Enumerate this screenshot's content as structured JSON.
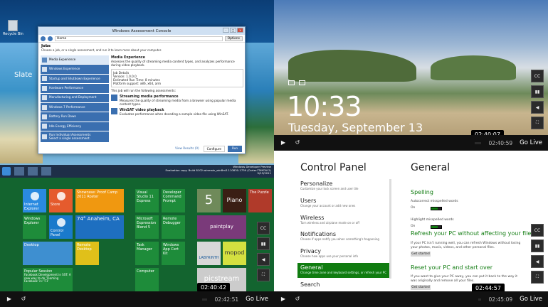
{
  "q1": {
    "desktop": {
      "recycle_label": "Recycle Bin",
      "slate_label": "Slate"
    },
    "window": {
      "title": "Windows Assessment Console",
      "nav_home": "Home",
      "options_label": "Options",
      "jobs_heading": "Jobs",
      "jobs_sub": "Choose a job, or a single assessment, and run it to learn more about your computer.",
      "jobs": [
        "Media Experience",
        "Windows Experience",
        "Startup and Shutdown Experience",
        "Hardware Performance",
        "Manufacturing and Deployment",
        "Windows 7 Performance",
        "Battery Run Down",
        "Idle Energy Efficiency",
        "Run Individual Assessments\nSelect a single assessment."
      ],
      "detail_title": "Media Experience",
      "detail_desc": "Assesses the quality of streaming media content types, and analyzes performance during video playback.",
      "job_details_label": "Job Details",
      "version_label": "Version:",
      "version_value": "1.0.0.0",
      "run_time_label": "Estimated Run Time:",
      "run_time_value": "8 minutes",
      "platform_label": "Platform support:",
      "platform_value": "x86, x64, arm",
      "runs_label": "This job will run the following assessments:",
      "assessments": [
        {
          "name": "Streaming media performance",
          "desc": "Measures the quality of streaming media from a browser using popular media content types."
        },
        {
          "name": "WinSAT video playback",
          "desc": "Evaluates performance when decoding a sample video file using WinSAT."
        }
      ],
      "view_results": "View Results (0)",
      "configure_label": "Configure",
      "run_label": "Run"
    },
    "taskbar": {
      "eval_line1": "Windows Developer Preview",
      "eval_line2": "Evaluation copy. Build 8102.winmain_win8m3.110830-1739 (Carter-T5MCW-2)",
      "clock": "9/13/2011"
    },
    "player": {
      "time": "02:40:42",
      "duration": "02:42:51",
      "go_live": "Go Live"
    }
  },
  "q2": {
    "lock_time": "10:33",
    "lock_date": "Tuesday, September 13",
    "player": {
      "time": "02:40:07",
      "duration": "02:40:59",
      "go_live": "Go Live"
    },
    "side_buttons": [
      "CC",
      "bars",
      "volume",
      "fullscreen"
    ]
  },
  "q3": {
    "tiles": [
      {
        "label": "Internet Explorer"
      },
      {
        "label": "Store"
      },
      {
        "label": "Showcase: Proof Camp 2011 Roster"
      },
      {
        "label": "Visual Studio 11 Express"
      },
      {
        "label": "Developer Command Prompt"
      },
      {
        "label": "5"
      },
      {
        "label": "Piano"
      },
      {
        "label": "The Puzzle"
      },
      {
        "label": "Windows Explorer"
      },
      {
        "label": "Control Panel"
      },
      {
        "label": "74° Anaheim, CA"
      },
      {
        "label": "Microsoft Expression Blend 5"
      },
      {
        "label": "Remote Debugger"
      },
      {
        "label": "paintplay"
      },
      {
        "label": "Desktop"
      },
      {
        "label": "Remote Desktop"
      },
      {
        "label": "Task Manager"
      },
      {
        "label": "Windows App Cert Kit"
      },
      {
        "label": "LABYRINTH"
      },
      {
        "label": "mopod"
      },
      {
        "label": "Popular Session"
      },
      {
        "label": "Computer"
      },
      {
        "label": "picstream"
      }
    ],
    "session_text": "Facebook Development in SST: A new way to do 'Teaming Facebook' in: 'F1'",
    "player": {
      "time": "02:40:42",
      "duration": "02:42:51",
      "go_live": "Go Live"
    }
  },
  "q4": {
    "cp_title": "Control Panel",
    "cp_items": [
      {
        "name": "Personalize",
        "desc": "Customize your lock screen and user tile"
      },
      {
        "name": "Users",
        "desc": "Change your account or add new ones"
      },
      {
        "name": "Wireless",
        "desc": "Turn wireless and airplane mode on or off"
      },
      {
        "name": "Notifications",
        "desc": "Choose if apps notify you when something's happening"
      },
      {
        "name": "Privacy",
        "desc": "Choose how apps use your personal info"
      },
      {
        "name": "General",
        "desc": "Change time zone and keyboard settings, or refresh your PC"
      },
      {
        "name": "Search",
        "desc": ""
      }
    ],
    "gen_title": "General",
    "spelling": "Spelling",
    "autocorrect": "Autocorrect misspelled words",
    "on1": "On",
    "highlight": "Highlight misspelled words",
    "on2": "On",
    "refresh_title": "Refresh your PC without affecting your files",
    "refresh_desc": "If your PC isn't running well, you can refresh Windows without losing your photos, music, videos, and other personal files.",
    "refresh_btn": "Get started",
    "reset_title": "Reset your PC and start over",
    "reset_desc": "If you want to give your PC away, you can put it back to the way it was originally and remove all your files.",
    "reset_btn": "Get started",
    "player": {
      "time": "02:44:57",
      "duration": "02:45:09",
      "go_live": "Go Live"
    }
  }
}
